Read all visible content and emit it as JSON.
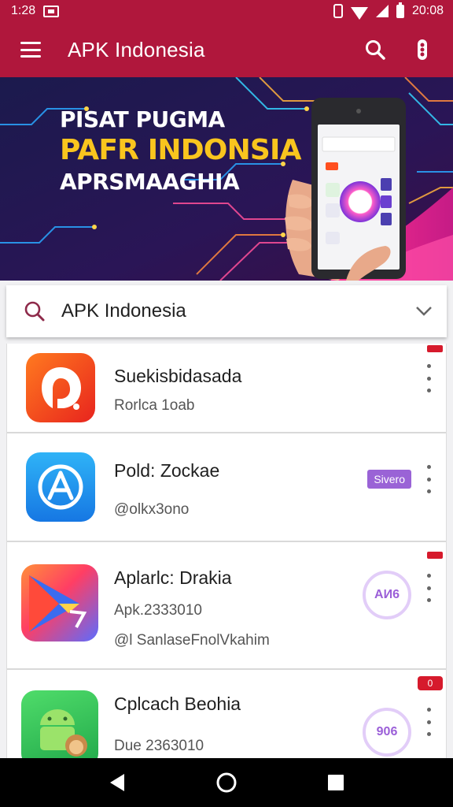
{
  "status_bar": {
    "time_left": "1:28",
    "time_right": "20:08"
  },
  "app_bar": {
    "title": "APK Indonesia"
  },
  "banner": {
    "line1": "PISAT PUGMA",
    "line2": "PAFR INDONSIA",
    "line3": "APRSMAAGHIA"
  },
  "search": {
    "value": "APK Indonesia"
  },
  "apps": [
    {
      "name": "Suekisbidasada",
      "sub1": "Rorlca 1oab"
    },
    {
      "name": "Pold: Zockae",
      "sub1": "@olkx3ono",
      "badge": "Sivero"
    },
    {
      "name": "Aplarlc: Drakia",
      "sub1": "Apk.2333010",
      "sub2": "@l SanlaseFnolVkahim",
      "badge": "AИ6"
    },
    {
      "name": "Cplcach Beohia",
      "sub1": "Due 2363010",
      "badge": "906",
      "notif": "0"
    }
  ],
  "colors": {
    "primary": "#b0173c",
    "badge_purple": "#9a63d6",
    "banner_bg": "#1d1547",
    "banner_yellow": "#f9c51e"
  }
}
